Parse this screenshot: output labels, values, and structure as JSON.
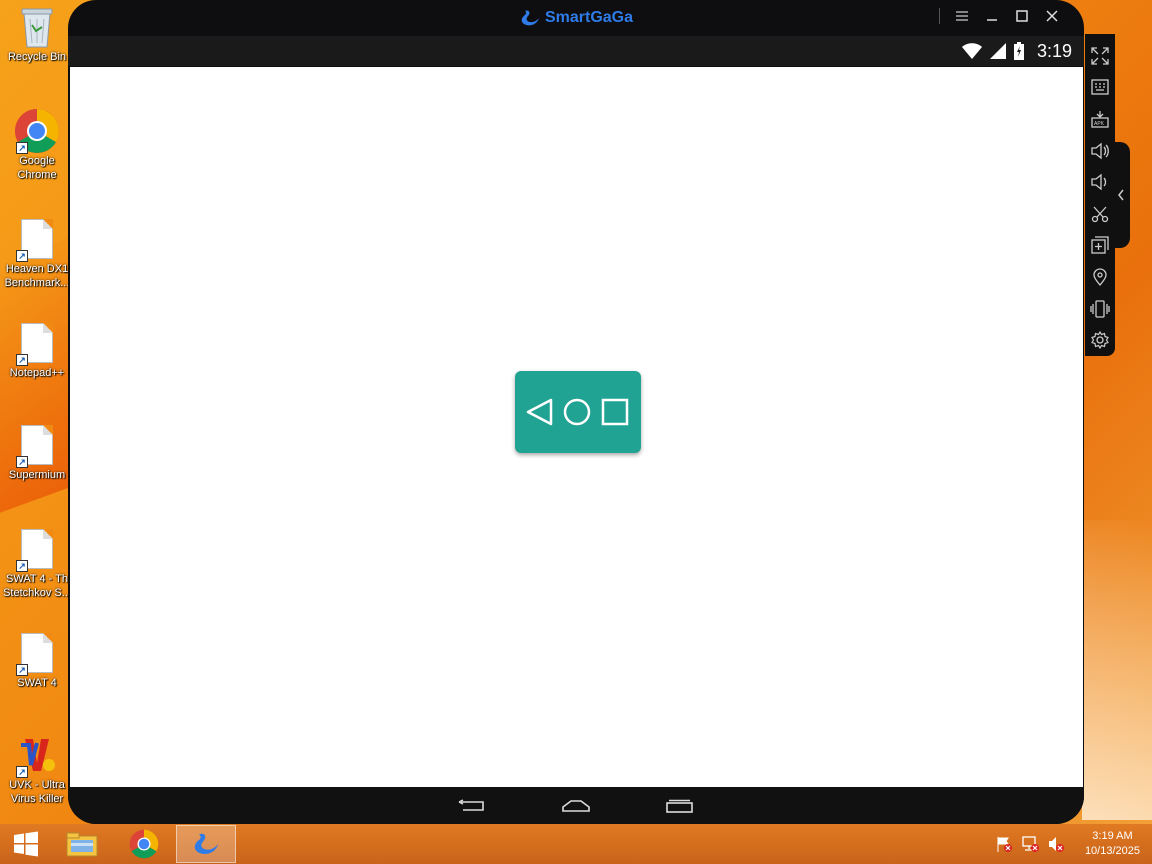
{
  "desktop": {
    "icons": [
      {
        "label": "Recycle Bin",
        "icon": "recycle-bin-icon"
      },
      {
        "label1": "Google",
        "label2": "Chrome",
        "icon": "chrome-icon"
      },
      {
        "label1": "Heaven DX1",
        "label2": "Benchmark...",
        "icon": "file-shortcut-icon"
      },
      {
        "label": "Notepad++",
        "icon": "file-shortcut-icon"
      },
      {
        "label": "Supermium",
        "icon": "file-shortcut-icon"
      },
      {
        "label1": "SWAT 4 - Th",
        "label2": "Stetchkov S...",
        "icon": "file-shortcut-icon"
      },
      {
        "label": "SWAT 4",
        "icon": "file-shortcut-icon"
      },
      {
        "label1": "UVK - Ultra",
        "label2": "Virus Killer",
        "icon": "uvk-icon"
      }
    ]
  },
  "emulator": {
    "title": "SmartGaGa",
    "status_time": "3:19",
    "app_icon": "navigation-bar-app-icon",
    "accent": "#21a394",
    "brand_color": "#2f7be8",
    "side_tools": [
      "fullscreen-icon",
      "keyboard-icon",
      "install-apk-icon",
      "volume-up-icon",
      "volume-down-icon",
      "screenshot-cut-icon",
      "multi-instance-icon",
      "location-icon",
      "shake-icon",
      "settings-icon"
    ]
  },
  "taskbar": {
    "time": "3:19 AM",
    "date": "10/13/2025"
  }
}
